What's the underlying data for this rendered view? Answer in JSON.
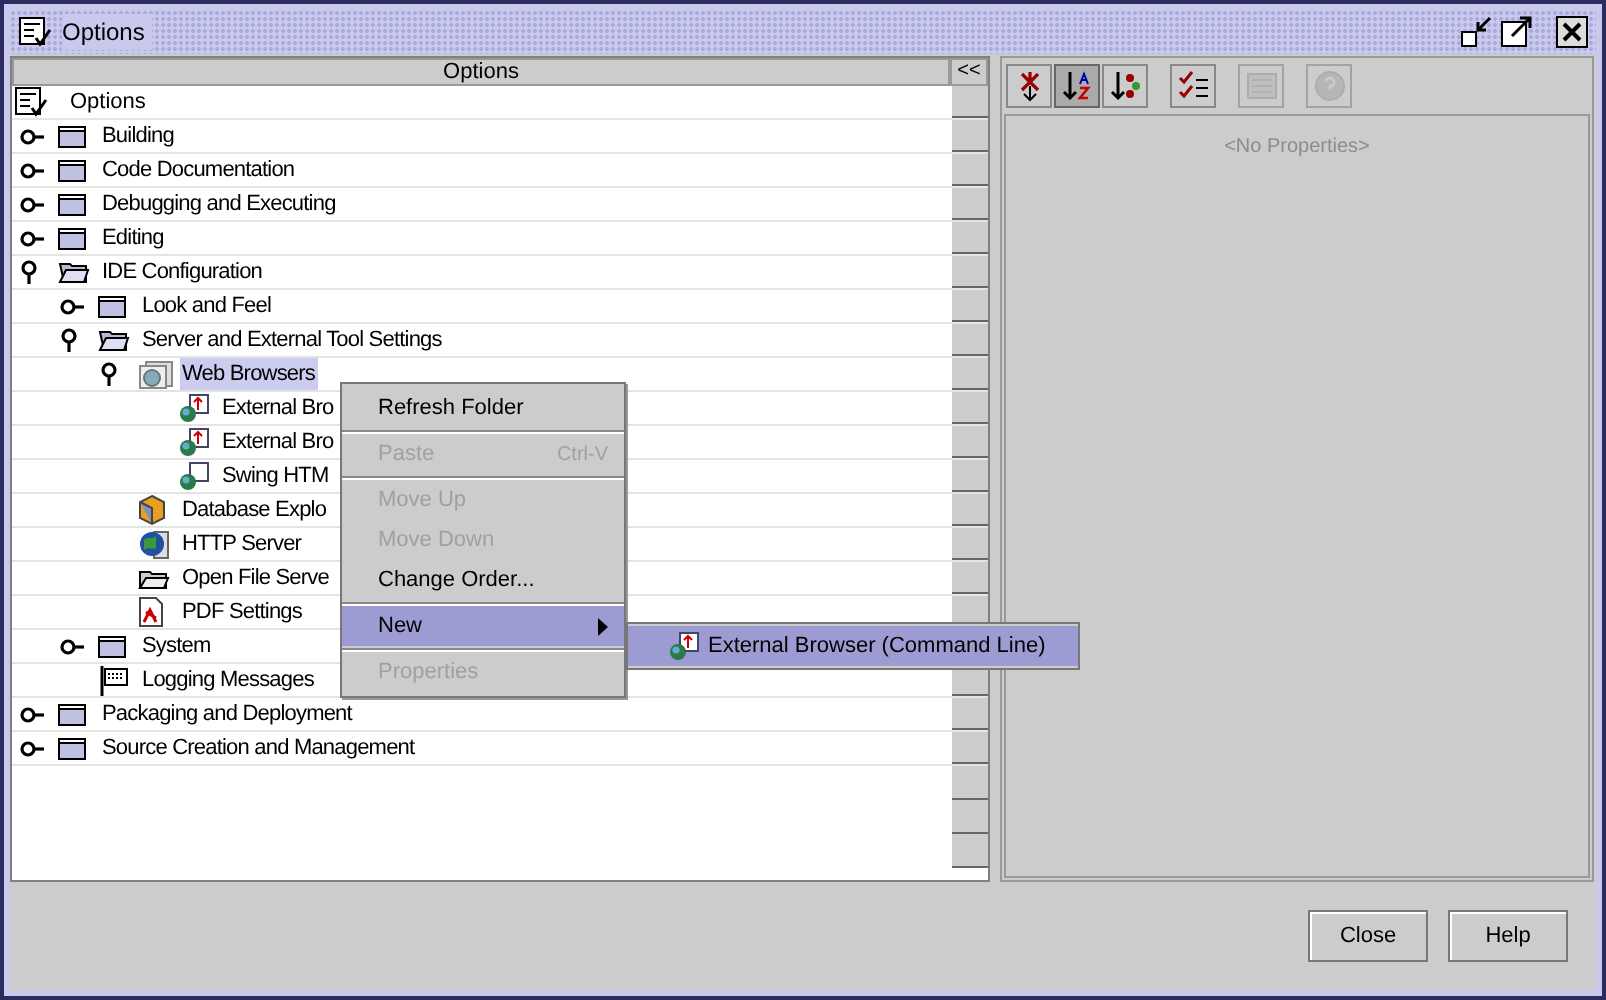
{
  "window": {
    "title": "Options"
  },
  "tree": {
    "header": "Options",
    "collapse_button": "<<",
    "root": "Options",
    "items": [
      {
        "label": "Building",
        "kind": "folder",
        "expanded": false,
        "selected": false
      },
      {
        "label": "Code Documentation",
        "kind": "folder",
        "expanded": false,
        "selected": false
      },
      {
        "label": "Debugging and Executing",
        "kind": "folder",
        "expanded": false,
        "selected": false
      },
      {
        "label": "Editing",
        "kind": "folder",
        "expanded": false,
        "selected": false
      },
      {
        "label": "IDE Configuration",
        "kind": "folder",
        "expanded": true,
        "selected": false,
        "children": [
          {
            "label": "Look and Feel",
            "kind": "folder",
            "expanded": false,
            "selected": false
          },
          {
            "label": "Server and External Tool Settings",
            "kind": "folder",
            "expanded": true,
            "selected": false,
            "children": [
              {
                "label": "Web Browsers",
                "kind": "browsers",
                "expanded": true,
                "selected": true,
                "children": [
                  {
                    "label": "External Bro",
                    "kind": "browser",
                    "selected": false
                  },
                  {
                    "label": "External Bro",
                    "kind": "browser",
                    "selected": false
                  },
                  {
                    "label": "Swing HTM",
                    "kind": "swing",
                    "selected": false
                  }
                ]
              },
              {
                "label": "Database Explo",
                "kind": "database",
                "selected": false
              },
              {
                "label": "HTTP Server",
                "kind": "http",
                "selected": false
              },
              {
                "label": "Open File Serve",
                "kind": "file",
                "selected": false
              },
              {
                "label": "PDF Settings",
                "kind": "pdf",
                "selected": false
              }
            ]
          },
          {
            "label": "System",
            "kind": "folder",
            "expanded": false,
            "selected": false
          },
          {
            "label": "Logging Messages",
            "kind": "log",
            "selected": false
          }
        ]
      },
      {
        "label": "Packaging and Deployment",
        "kind": "folder",
        "expanded": false,
        "selected": false
      },
      {
        "label": "Source Creation and Management",
        "kind": "folder",
        "expanded": false,
        "selected": false
      }
    ]
  },
  "context_menu": {
    "groups": [
      [
        {
          "label": "Refresh Folder",
          "disabled": false,
          "selected": false
        }
      ],
      [
        {
          "label": "Paste",
          "shortcut": "Ctrl-V",
          "disabled": true,
          "selected": false
        }
      ],
      [
        {
          "label": "Move Up",
          "disabled": true,
          "selected": false
        },
        {
          "label": "Move Down",
          "disabled": true,
          "selected": false
        },
        {
          "label": "Change Order...",
          "disabled": false,
          "selected": false
        }
      ],
      [
        {
          "label": "New",
          "submenu": true,
          "disabled": false,
          "selected": true
        }
      ],
      [
        {
          "label": "Properties",
          "disabled": true,
          "selected": false
        }
      ]
    ]
  },
  "submenu": {
    "items": [
      {
        "label": "External Browser (Command Line)",
        "selected": true
      }
    ]
  },
  "properties": {
    "toolbar": [
      {
        "kind": "unsorted",
        "pressed": false,
        "disabled": false
      },
      {
        "kind": "sort-name",
        "pressed": true,
        "disabled": false
      },
      {
        "kind": "sort-type",
        "pressed": false,
        "disabled": false
      },
      {
        "kind": "checklist",
        "pressed": false,
        "disabled": false
      },
      {
        "kind": "sheet",
        "pressed": false,
        "disabled": true
      },
      {
        "kind": "help",
        "pressed": false,
        "disabled": true
      }
    ],
    "empty_text": "<No Properties>"
  },
  "buttons": [
    {
      "label": "Close"
    },
    {
      "label": "Help"
    }
  ]
}
